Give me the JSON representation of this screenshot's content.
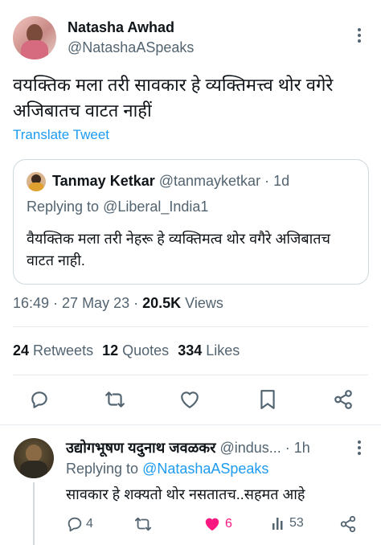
{
  "tweet": {
    "author_name": "Natasha Awhad",
    "author_handle": "@NatashaASpeaks",
    "text_line1": "वयक्तिक मला तरी सावकार हे व्यक्तिमत्त्व थोर वगेरे",
    "text_line2": "अजिबातच वाटत नाहीं",
    "translate_label": "Translate Tweet",
    "timestamp": "16:49 · 27 May 23 · ",
    "views_count": "20.5K",
    "views_label": " Views",
    "retweets_count": "24",
    "retweets_label": " Retweets",
    "quotes_count": "12",
    "quotes_label": " Quotes",
    "likes_count": "334",
    "likes_label": " Likes"
  },
  "quoted": {
    "author_name": "Tanmay Ketkar",
    "author_handle": "@tanmayketkar",
    "time": " · 1d",
    "replying_prefix": "Replying to ",
    "replying_handle": "@Liberal_India1",
    "text_line1": "वैयक्तिक मला तरी नेहरू हे व्यक्तिमत्व थोर वगैरे अजिबातच",
    "text_line2": "वाटत नाही."
  },
  "reply": {
    "author_name": "उद्योगभूषण यदुनाथ जवळकर",
    "author_handle": "@indus...",
    "time": " · 1h",
    "replying_prefix": "Replying to ",
    "replying_handle": "@NatashaASpeaks",
    "text": "सावकार हे शक्यतो थोर नसतातच..सहमत आहे",
    "replies_count": "4",
    "likes_count": "6",
    "views_count": "53"
  },
  "colors": {
    "accent": "#1d9bf0",
    "like_pink": "#f91880",
    "muted": "#536471",
    "border": "#cfd9de"
  },
  "icons": [
    "more-icon",
    "reply-icon",
    "retweet-icon",
    "like-icon",
    "bookmark-icon",
    "share-icon",
    "views-icon"
  ]
}
